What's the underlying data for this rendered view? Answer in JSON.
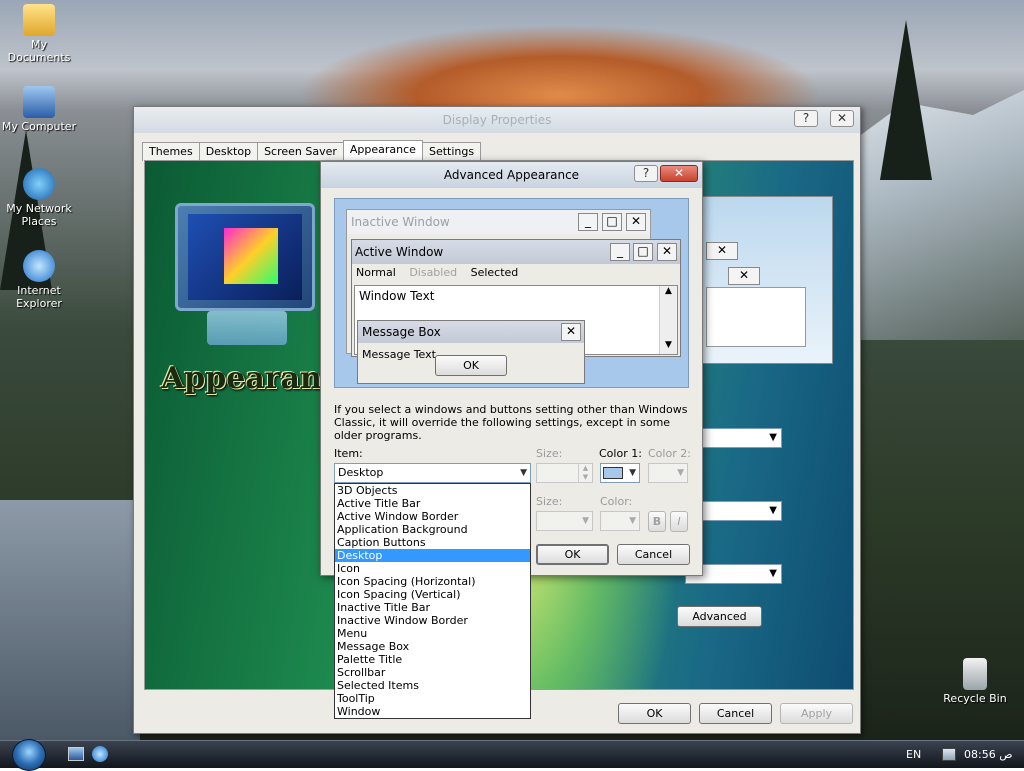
{
  "desktop": {
    "icons": [
      {
        "label": "My Documents",
        "icon": "folder-icon"
      },
      {
        "label": "My Computer",
        "icon": "computer-icon"
      },
      {
        "label": "My Network Places",
        "icon": "network-icon"
      },
      {
        "label": "Internet Explorer",
        "icon": "ie-icon"
      },
      {
        "label": "Recycle Bin",
        "icon": "recycle-bin-icon"
      }
    ]
  },
  "display_properties": {
    "title": "Display Properties",
    "help_glyph": "?",
    "close_glyph": "✕",
    "tabs": [
      "Themes",
      "Desktop",
      "Screen Saver",
      "Appearance",
      "Settings"
    ],
    "active_tab": "Appearance",
    "panel_heading": "Appearanc",
    "advanced_label": "Advanced",
    "ok_label": "OK",
    "cancel_label": "Cancel",
    "apply_label": "Apply"
  },
  "advanced_appearance": {
    "title": "Advanced Appearance",
    "help_glyph": "?",
    "close_glyph": "✕",
    "preview": {
      "inactive_title": "Inactive Window",
      "active_title": "Active Window",
      "menu_normal": "Normal",
      "menu_disabled": "Disabled",
      "menu_selected": "Selected",
      "window_text": "Window Text",
      "msgbox_title": "Message Box",
      "msgbox_text": "Message Text",
      "msgbox_ok": "OK",
      "min_glyph": "_",
      "max_glyph": "□",
      "close_glyph": "✕"
    },
    "info": "If you select a windows and buttons setting other than Windows Classic, it will override the following settings, except in some older programs.",
    "item_label": "Item:",
    "item_value": "Desktop",
    "size_label": "Size:",
    "color1_label": "Color 1:",
    "color2_label": "Color 2:",
    "font_size_label": "Size:",
    "font_color_label": "Color:",
    "bold_label": "B",
    "italic_label": "I",
    "ok_label": "OK",
    "cancel_label": "Cancel",
    "color1_swatch": "#a7c8ea"
  },
  "item_list": {
    "options": [
      "3D Objects",
      "Active Title Bar",
      "Active Window Border",
      "Application Background",
      "Caption Buttons",
      "Desktop",
      "Icon",
      "Icon Spacing (Horizontal)",
      "Icon Spacing (Vertical)",
      "Inactive Title Bar",
      "Inactive Window Border",
      "Menu",
      "Message Box",
      "Palette Title",
      "Scrollbar",
      "Selected Items",
      "ToolTip",
      "Window"
    ],
    "selected_index": 5
  },
  "taskbar": {
    "language": "EN",
    "clock": "08:56 ص"
  }
}
